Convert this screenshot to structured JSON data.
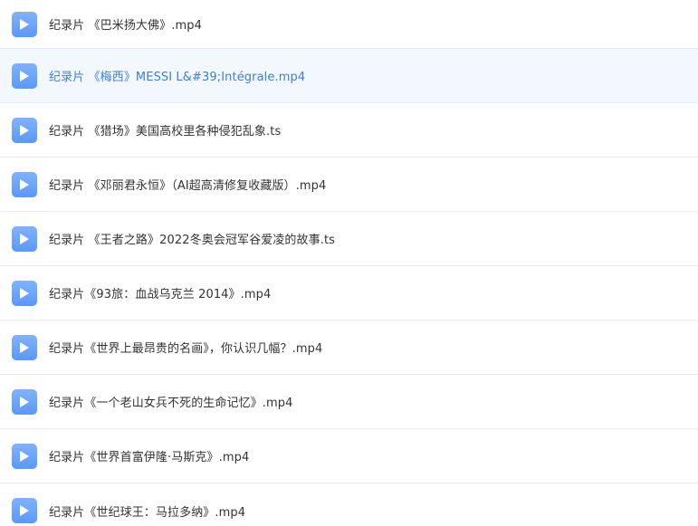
{
  "files": [
    {
      "name": "纪录片 《巴米扬大佛》.mp4",
      "icon": "video-file-icon"
    },
    {
      "name": "纪录片 《梅西》MESSI L&#39;Intégrale.mp4",
      "icon": "video-file-icon"
    },
    {
      "name": "纪录片 《猎场》美国高校里各种侵犯乱象.ts",
      "icon": "video-file-icon"
    },
    {
      "name": "纪录片 《邓丽君永恒》（AI超高清修复收藏版）.mp4",
      "icon": "video-file-icon"
    },
    {
      "name": "纪录片 《王者之路》2022冬奥会冠军谷爱凌的故事.ts",
      "icon": "video-file-icon"
    },
    {
      "name": "纪录片《93旅：血战乌克兰 2014》.mp4",
      "icon": "video-file-icon"
    },
    {
      "name": "纪录片《世界上最昂贵的名画》，你认识几幅？.mp4",
      "icon": "video-file-icon"
    },
    {
      "name": "纪录片《一个老山女兵不死的生命记忆》.mp4",
      "icon": "video-file-icon"
    },
    {
      "name": "纪录片《世界首富伊隆·马斯克》.mp4",
      "icon": "video-file-icon"
    },
    {
      "name": "纪录片《世纪球王：马拉多纳》.mp4",
      "icon": "video-file-icon"
    }
  ],
  "colors": {
    "icon_bg": "#6aa3fc",
    "hover_bg": "#f3f8ff",
    "hover_text": "#3d7fd6",
    "text": "#333333",
    "divider": "#e8ebf0"
  }
}
